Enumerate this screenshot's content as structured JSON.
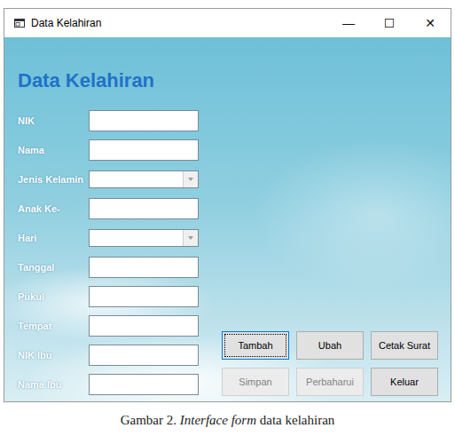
{
  "window": {
    "title": "Data Kelahiran",
    "controls": [
      "—",
      "☐",
      "✕"
    ]
  },
  "heading": "Data Kelahiran",
  "fields": [
    {
      "label": "NIK",
      "kind": "text"
    },
    {
      "label": "Nama",
      "kind": "text"
    },
    {
      "label": "Jenis Kelamin",
      "kind": "combo"
    },
    {
      "label": "Anak Ke-",
      "kind": "text"
    },
    {
      "label": "Hari",
      "kind": "combo"
    },
    {
      "label": "Tanggal",
      "kind": "text"
    },
    {
      "label": "Pukul",
      "kind": "text"
    },
    {
      "label": "Tempat",
      "kind": "text"
    },
    {
      "label": "NIK Ibu",
      "kind": "text"
    },
    {
      "label": "Nama Ibu",
      "kind": "text"
    }
  ],
  "buttons": [
    {
      "label": "Tambah",
      "disabled": false,
      "focused": true
    },
    {
      "label": "Ubah",
      "disabled": false,
      "focused": false
    },
    {
      "label": "Cetak Surat",
      "disabled": false,
      "focused": false
    },
    {
      "label": "Simpan",
      "disabled": true,
      "focused": false
    },
    {
      "label": "Perbaharui",
      "disabled": true,
      "focused": false
    },
    {
      "label": "Keluar",
      "disabled": false,
      "focused": false
    }
  ],
  "caption": [
    {
      "text": "Gambar 2. ",
      "italic": false
    },
    {
      "text": "Interface form",
      "italic": true
    },
    {
      "text": " data kelahiran",
      "italic": false
    }
  ]
}
